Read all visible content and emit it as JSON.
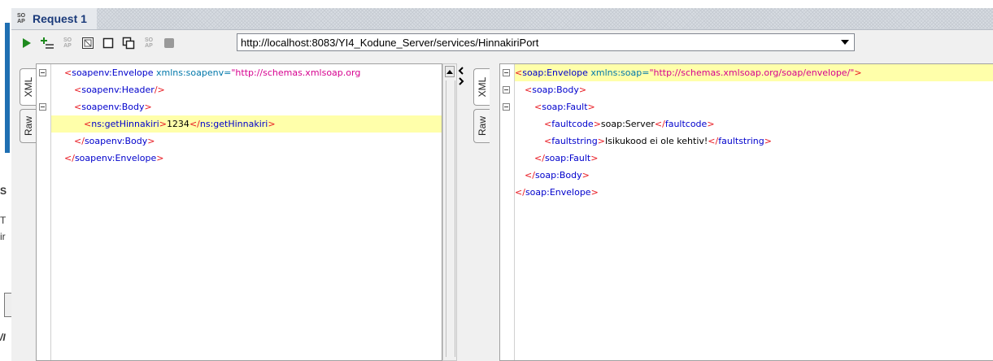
{
  "window": {
    "title": "Request 1",
    "icon": "soap-ap-icon"
  },
  "background_app": {
    "letters": [
      "S",
      "T",
      "ir",
      "/I"
    ]
  },
  "toolbar": {
    "buttons": [
      {
        "name": "submit-request-button",
        "icon": "play-icon"
      },
      {
        "name": "add-assertion-button",
        "icon": "add-list-icon"
      },
      {
        "name": "create-soap-button",
        "icon": "soap-ap-icon"
      },
      {
        "name": "create-empty-request-button",
        "icon": "box-icon"
      },
      {
        "name": "open-window-button",
        "icon": "window-icon"
      },
      {
        "name": "clone-request-button",
        "icon": "clone-icon"
      },
      {
        "name": "soap-settings-button",
        "icon": "soap-ap-icon"
      },
      {
        "name": "cancel-request-button",
        "icon": "stop-icon"
      }
    ],
    "endpoint_url": "http://localhost:8083/YI4_Kodune_Server/services/HinnakiriPort"
  },
  "request_tabs": [
    "XML",
    "Raw"
  ],
  "response_tabs": [
    "XML",
    "Raw"
  ],
  "request_xml": {
    "line1_open": "<",
    "line1_tag": "soapenv:Envelope",
    "line1_attr": " xmlns:soapenv=",
    "line1_val": "\"http://schemas.xmlsoap.org",
    "line2_open": "<",
    "line2_tag": "soapenv:Header",
    "line2_close": "/>",
    "line3_open": "<",
    "line3_tag": "soapenv:Body",
    "line3_close": ">",
    "line4_open": "<",
    "line4_tag": "ns:getHinnakiri",
    "line4_close": ">",
    "line4_text": "1234",
    "line4_end_open": "</",
    "line4_end_tag": "ns:getHinnakiri",
    "line4_end_close": ">",
    "line5_open": "</",
    "line5_tag": "soapenv:Body",
    "line5_close": ">",
    "line6_open": "</",
    "line6_tag": "soapenv:Envelope",
    "line6_close": ">"
  },
  "response_xml": {
    "line1_open": "<",
    "line1_tag": "soap:Envelope",
    "line1_attr": " xmlns:soap=",
    "line1_val": "\"http://schemas.xmlsoap.org/soap/envelope/\"",
    "line1_close": ">",
    "line2_open": "<",
    "line2_tag": "soap:Body",
    "line2_close": ">",
    "line3_open": "<",
    "line3_tag": "soap:Fault",
    "line3_close": ">",
    "line4_open": "<",
    "line4_tag": "faultcode",
    "line4_close": ">",
    "line4_text": "soap:Server",
    "line4_end_open": "</",
    "line4_end_tag": "faultcode",
    "line4_end_close": ">",
    "line5_open": "<",
    "line5_tag": "faultstring",
    "line5_close": ">",
    "line5_text": "Isikukood ei ole kehtiv!",
    "line5_end_open": "</",
    "line5_end_tag": "faultstring",
    "line5_end_close": ">",
    "line6_open": "</",
    "line6_tag": "soap:Fault",
    "line6_close": ">",
    "line7_open": "</",
    "line7_tag": "soap:Body",
    "line7_close": ">",
    "line8_open": "</",
    "line8_tag": "soap:Envelope",
    "line8_close": ">"
  },
  "colors": {
    "highlight": "#ffffaa",
    "tag": "#0000cc",
    "punct": "#e8171f",
    "attr_value": "#d6008f",
    "title": "#1a3a7a"
  }
}
